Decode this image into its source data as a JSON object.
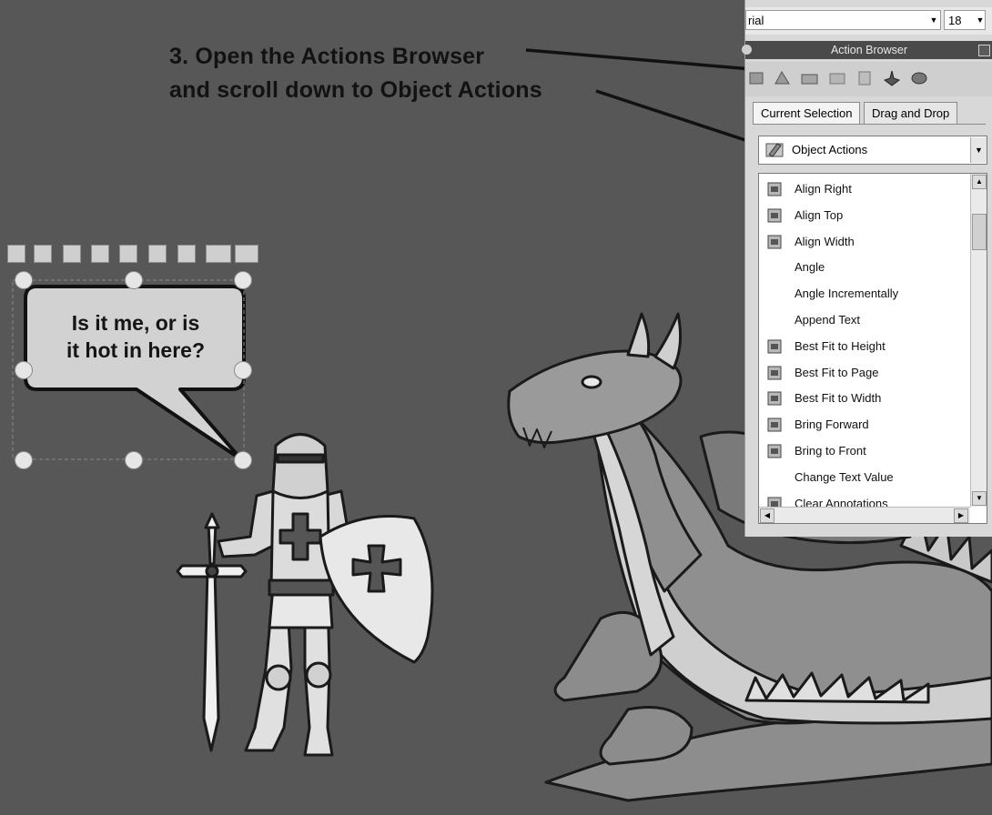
{
  "instruction": {
    "line1": "3. Open the Actions Browser",
    "line2": "and scroll down to Object Actions"
  },
  "speech_bubble": {
    "line1": "Is it me, or is",
    "line2": "it hot in here?"
  },
  "font_toolbar": {
    "font_name": "rial",
    "font_size": "18"
  },
  "action_browser": {
    "title": "Action Browser",
    "tabs": [
      {
        "label": "Current Selection",
        "active": true
      },
      {
        "label": "Drag and Drop",
        "active": false
      }
    ],
    "category": "Object Actions",
    "items": [
      {
        "label": "Align Right",
        "icon": "align-right-icon"
      },
      {
        "label": "Align Top",
        "icon": "align-top-icon"
      },
      {
        "label": "Align Width",
        "icon": "align-width-icon"
      },
      {
        "label": "Angle",
        "icon": ""
      },
      {
        "label": "Angle Incrementally",
        "icon": ""
      },
      {
        "label": "Append Text",
        "icon": ""
      },
      {
        "label": "Best Fit to Height",
        "icon": "best-fit-height-icon"
      },
      {
        "label": "Best Fit to Page",
        "icon": "best-fit-page-icon"
      },
      {
        "label": "Best Fit to Width",
        "icon": "best-fit-width-icon"
      },
      {
        "label": "Bring Forward",
        "icon": "bring-forward-icon"
      },
      {
        "label": "Bring to Front",
        "icon": "bring-to-front-icon"
      },
      {
        "label": "Change Text Value",
        "icon": ""
      },
      {
        "label": "Clear Annotations",
        "icon": "clear-annotations-icon"
      }
    ]
  },
  "colors": {
    "background": "#575757",
    "panel": "#d8d8d8",
    "titlebar": "#4a4a4a"
  }
}
